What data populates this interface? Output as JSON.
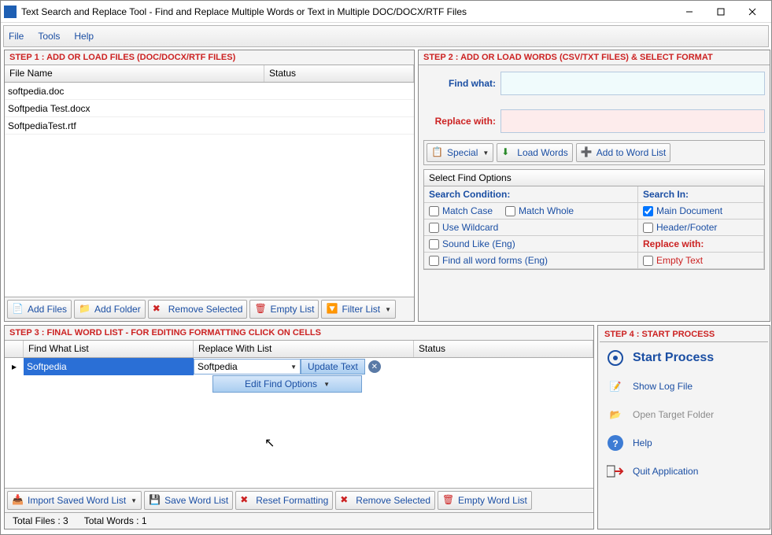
{
  "title": "Text Search and Replace Tool  - Find and Replace Multiple Words or Text  in Multiple DOC/DOCX/RTF Files",
  "menu": {
    "file": "File",
    "tools": "Tools",
    "help": "Help"
  },
  "step1": {
    "header": "STEP 1 : ADD OR LOAD FILES (DOC/DOCX/RTF FILES)",
    "cols": {
      "filename": "File Name",
      "status": "Status"
    },
    "files": [
      {
        "name": "softpedia.doc",
        "status": ""
      },
      {
        "name": "Softpedia Test.docx",
        "status": ""
      },
      {
        "name": "SoftpediaTest.rtf",
        "status": ""
      }
    ],
    "buttons": {
      "addFiles": "Add Files",
      "addFolder": "Add Folder",
      "removeSelected": "Remove Selected",
      "emptyList": "Empty List",
      "filterList": "Filter List"
    }
  },
  "step2": {
    "header": "STEP 2 : ADD OR LOAD WORDS (CSV/TXT FILES) & SELECT FORMAT",
    "findLabel": "Find what:",
    "replaceLabel": "Replace with:",
    "findValue": "",
    "replaceValue": "",
    "buttons": {
      "special": "Special",
      "loadWords": "Load Words",
      "addToList": "Add to Word List"
    },
    "findOptions": {
      "title": "Select Find Options",
      "searchCondition": "Search Condition:",
      "searchIn": "Search In:",
      "matchCase": "Match Case",
      "matchWhole": "Match Whole",
      "useWildcard": "Use Wildcard",
      "soundLike": "Sound Like (Eng)",
      "findAllForms": "Find all word forms (Eng)",
      "mainDocument": "Main Document",
      "headerFooter": "Header/Footer",
      "replaceWithHead": "Replace with:",
      "emptyText": "Empty Text",
      "checked": {
        "matchCase": false,
        "matchWhole": false,
        "useWildcard": false,
        "soundLike": false,
        "findAllForms": false,
        "mainDocument": true,
        "headerFooter": false,
        "emptyText": false
      }
    }
  },
  "step3": {
    "header": "STEP 3 : FINAL WORD LIST - FOR EDITING FORMATTING CLICK ON CELLS",
    "cols": {
      "find": "Find What List",
      "replace": "Replace With List",
      "status": "Status"
    },
    "row": {
      "find": "Softpedia",
      "replace": "Softpedia"
    },
    "updateText": "Update Text",
    "editFindOptions": "Edit Find Options",
    "buttons": {
      "import": "Import Saved Word List",
      "save": "Save Word List",
      "reset": "Reset Formatting",
      "remove": "Remove Selected",
      "empty": "Empty Word List"
    }
  },
  "step4": {
    "header": "STEP 4 : START PROCESS",
    "start": "Start Process",
    "showLog": "Show Log File",
    "openTarget": "Open Target Folder",
    "help": "Help",
    "quit": "Quit Application"
  },
  "statusbar": {
    "totalFiles": "Total Files : 3",
    "totalWords": "Total Words : 1"
  }
}
